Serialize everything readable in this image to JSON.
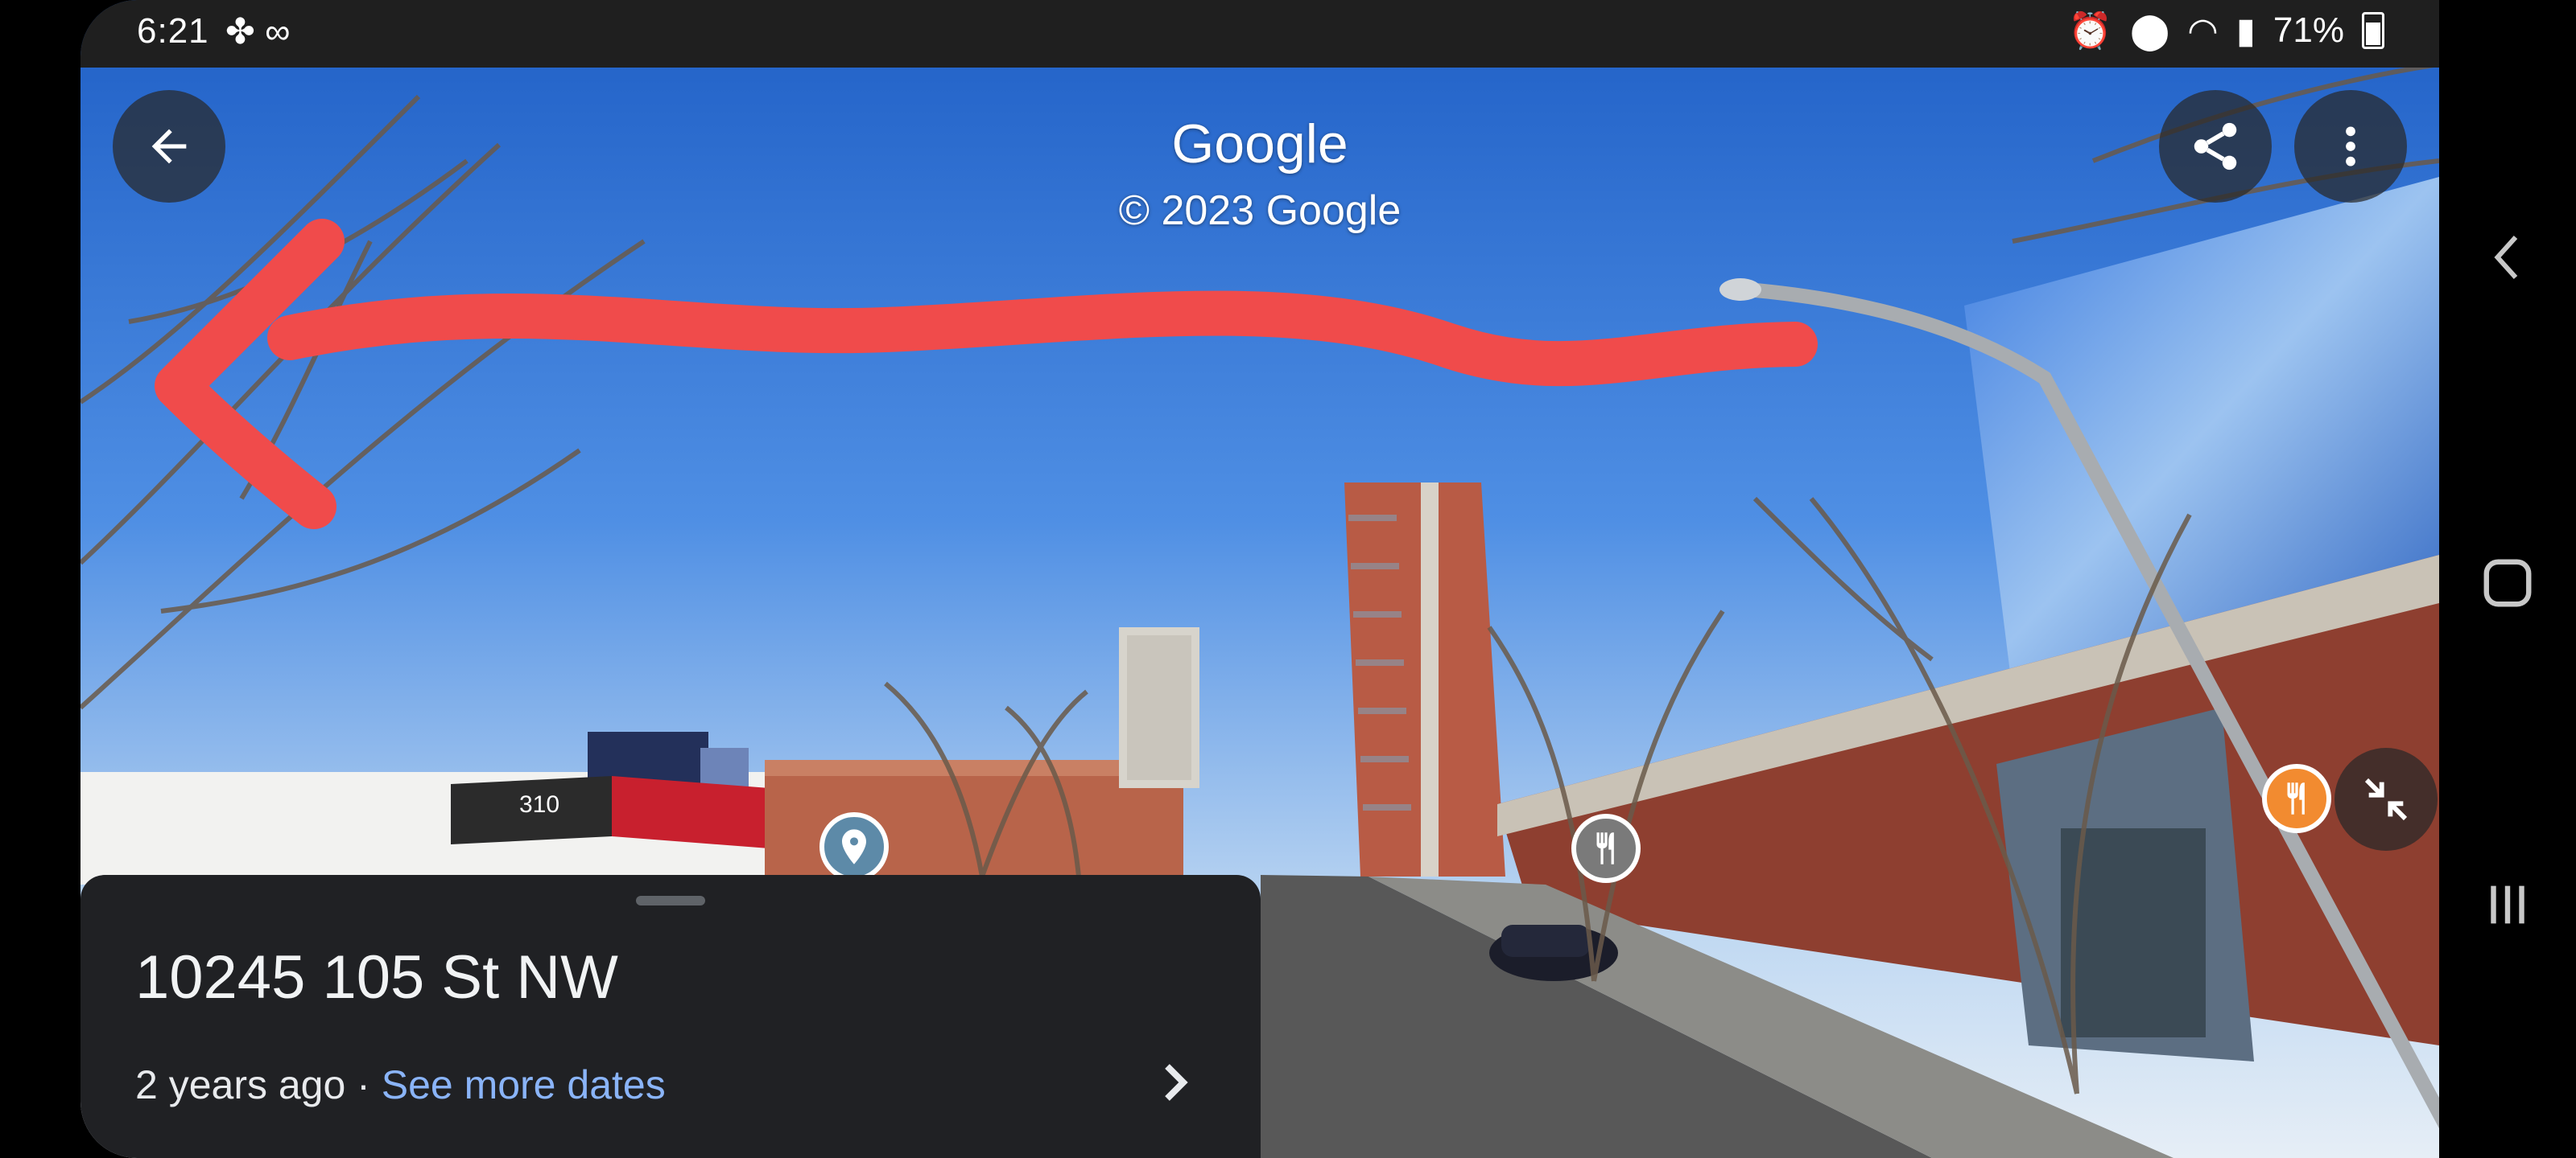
{
  "status_bar": {
    "time": "6:21",
    "left_icons": [
      "pinwheel-icon",
      "voicemail-icon"
    ],
    "right_icons": [
      "alarm-icon",
      "location-icon",
      "wifi-icon",
      "signal-icon",
      "battery-icon"
    ],
    "battery": "71%"
  },
  "watermark": {
    "brand": "Google",
    "copyright": "© 2023 Google"
  },
  "toolbar": {
    "back_icon": "back-arrow-icon",
    "share_icon": "share-icon",
    "more_icon": "more-vert-icon"
  },
  "info_panel": {
    "address": "10245 105 St NW",
    "age": "2 years ago",
    "separator": " · ",
    "see_more": "See more dates"
  },
  "scene_labels": {
    "billboard": "310"
  },
  "colors": {
    "panel_bg": "#202124",
    "link": "#8ab4f8",
    "annotation_red": "#f04b4b",
    "restaurant_orange": "#f28b30"
  },
  "nav_bar": {
    "icons": [
      "nav-back-icon",
      "nav-home-icon",
      "nav-recents-icon"
    ]
  }
}
